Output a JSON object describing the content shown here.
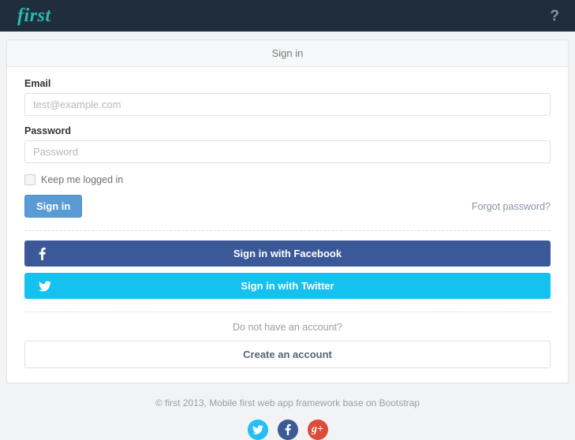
{
  "header": {
    "brand": "first",
    "help_icon": "question-mark-icon",
    "help_label": "?",
    "background_color": "#1f2d3d",
    "brand_color": "#2bbbad"
  },
  "panel": {
    "title": "Sign in",
    "form": {
      "email": {
        "label": "Email",
        "placeholder": "test@example.com",
        "value": ""
      },
      "password": {
        "label": "Password",
        "placeholder": "Password",
        "value": ""
      },
      "remember": {
        "label": "Keep me logged in",
        "checked": false
      },
      "submit_label": "Sign in",
      "forgot_label": "Forgot password?"
    },
    "social": {
      "facebook": {
        "label": "Sign in with Facebook",
        "icon": "facebook-icon",
        "glyph": "f",
        "color": "#3b5998"
      },
      "twitter": {
        "label": "Sign in with Twitter",
        "icon": "twitter-icon",
        "color": "#14c1ef"
      }
    },
    "signup": {
      "prompt": "Do not have an account?",
      "button_label": "Create an account"
    }
  },
  "footer": {
    "copyright": "© first 2013, Mobile first web app framework base on Bootstrap",
    "social_links": [
      {
        "name": "twitter",
        "icon": "twitter-circle-icon",
        "color": "#22c0f3"
      },
      {
        "name": "facebook",
        "icon": "facebook-circle-icon",
        "glyph": "f",
        "color": "#3b5a96"
      },
      {
        "name": "google-plus",
        "icon": "google-plus-circle-icon",
        "glyph": "g+",
        "color": "#dd4b39"
      }
    ]
  }
}
